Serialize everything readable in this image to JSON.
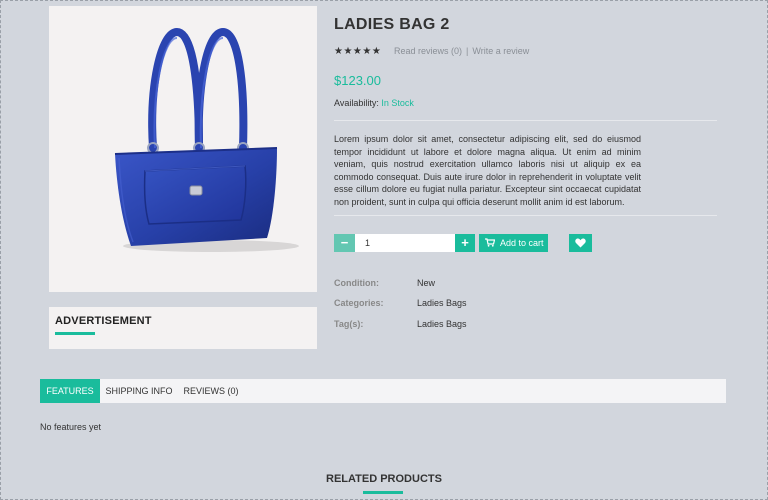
{
  "product": {
    "title": "LADIES BAG 2",
    "rating_stars": "★★★★★",
    "read_reviews": "Read reviews (0)",
    "separator": "|",
    "write_review": "Write a review",
    "price": "$123.00",
    "availability_label": "Availability:",
    "availability_value": "In Stock",
    "description": "Lorem ipsum dolor sit amet, consectetur adipiscing elit, sed do eiusmod tempor incididunt ut labore et dolore magna aliqua. Ut enim ad minim veniam, quis nostrud exercitation ullamco laboris nisi ut aliquip ex ea commodo consequat. Duis aute irure dolor in reprehenderit in voluptate velit esse cillum dolore eu fugiat nulla pariatur. Excepteur sint occaecat cupidatat non proident, sunt in culpa qui officia deserunt mollit anim id est laborum.",
    "image_icon": "handbag-image"
  },
  "cart": {
    "minus": "−",
    "quantity": "1",
    "plus": "+",
    "add_to_cart": "Add to cart",
    "cart_icon": "shopping-cart-icon",
    "wishlist_icon": "heart-icon"
  },
  "meta": {
    "condition_label": "Condition:",
    "condition_value": "New",
    "categories_label": "Categories:",
    "categories_value": "Ladies Bags",
    "tags_label": "Tag(s):",
    "tags_value": "Ladies Bags"
  },
  "sidebar": {
    "advertisement_title": "ADVERTISEMENT"
  },
  "tabs": {
    "items": [
      {
        "label": "FEATURES",
        "active": true
      },
      {
        "label": "SHIPPING INFO",
        "active": false
      },
      {
        "label": "REVIEWS (0)",
        "active": false
      }
    ],
    "content": "No features yet"
  },
  "related": {
    "title": "RELATED PRODUCTS"
  },
  "colors": {
    "accent": "#1abc9c",
    "background": "#d2d6dd",
    "panel": "#f4f2f2",
    "bag_blue": "#2740a8"
  }
}
